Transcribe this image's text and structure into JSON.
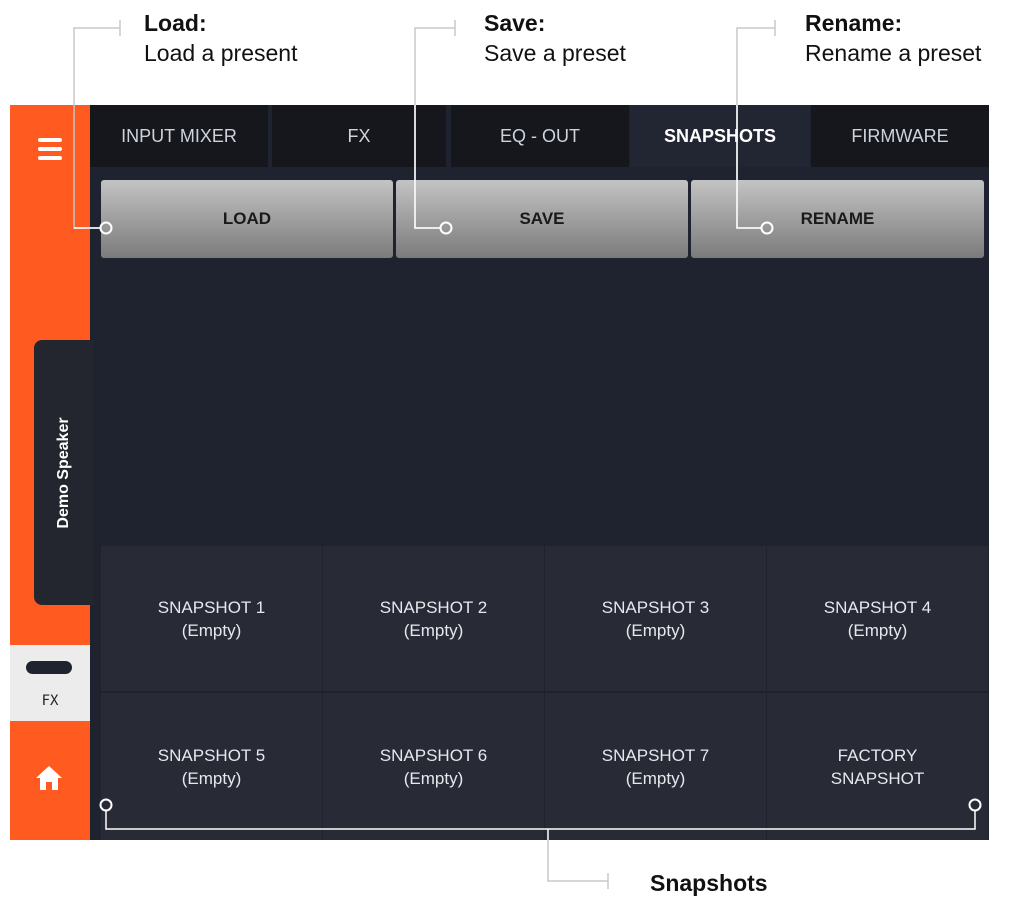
{
  "callouts": {
    "load": {
      "title": "Load:",
      "desc": "Load a present"
    },
    "save": {
      "title": "Save:",
      "desc": "Save a preset"
    },
    "rename": {
      "title": "Rename:",
      "desc": "Rename a preset"
    },
    "snapshots": {
      "title": "Snapshots"
    }
  },
  "sidebar": {
    "device_name": "Demo Speaker",
    "fx_label": "FX"
  },
  "tabs": [
    {
      "label": "INPUT MIXER"
    },
    {
      "label": "FX"
    },
    {
      "label": "EQ - OUT"
    },
    {
      "label": "SNAPSHOTS"
    },
    {
      "label": "FIRMWARE"
    }
  ],
  "active_tab": "SNAPSHOTS",
  "actions": {
    "load": "LOAD",
    "save": "SAVE",
    "rename": "RENAME"
  },
  "snapshots": [
    {
      "name": "SNAPSHOT 1",
      "status": "(Empty)"
    },
    {
      "name": "SNAPSHOT 2",
      "status": "(Empty)"
    },
    {
      "name": "SNAPSHOT 3",
      "status": "(Empty)"
    },
    {
      "name": "SNAPSHOT 4",
      "status": "(Empty)"
    },
    {
      "name": "SNAPSHOT 5",
      "status": "(Empty)"
    },
    {
      "name": "SNAPSHOT 6",
      "status": "(Empty)"
    },
    {
      "name": "SNAPSHOT 7",
      "status": "(Empty)"
    },
    {
      "name": "FACTORY",
      "status": "SNAPSHOT"
    }
  ],
  "colors": {
    "sidebar": "#ff5a1f",
    "background": "#1f2330",
    "cell": "#282b35"
  },
  "icons": [
    "hamburger-menu-icon",
    "home-icon"
  ]
}
